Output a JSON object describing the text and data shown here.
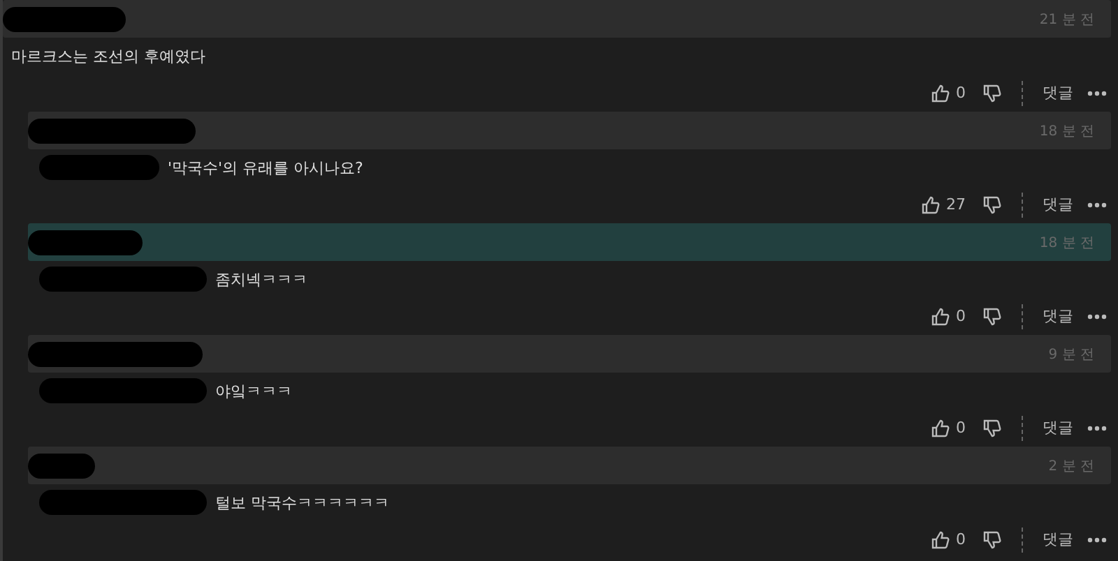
{
  "comments": [
    {
      "time": "21 분 전",
      "text": "마르크스는 조선의 후예였다",
      "mention": false,
      "highlighted": false,
      "likes": "0",
      "reply_label": "댓글"
    },
    {
      "time": "18 분 전",
      "text": "'막국수'의 유래를 아시나요?",
      "mention": true,
      "highlighted": false,
      "likes": "27",
      "reply_label": "댓글"
    },
    {
      "time": "18 분 전",
      "text": "좀치넥ㅋㅋㅋ",
      "mention": true,
      "highlighted": true,
      "likes": "0",
      "reply_label": "댓글"
    },
    {
      "time": "9 분 전",
      "text": "야잌ㅋㅋㅋ",
      "mention": true,
      "highlighted": false,
      "likes": "0",
      "reply_label": "댓글"
    },
    {
      "time": "2 분 전",
      "text": "털보 막국수ㅋㅋㅋㅋㅋㅋ",
      "mention": true,
      "highlighted": false,
      "likes": "0",
      "reply_label": "댓글"
    }
  ]
}
